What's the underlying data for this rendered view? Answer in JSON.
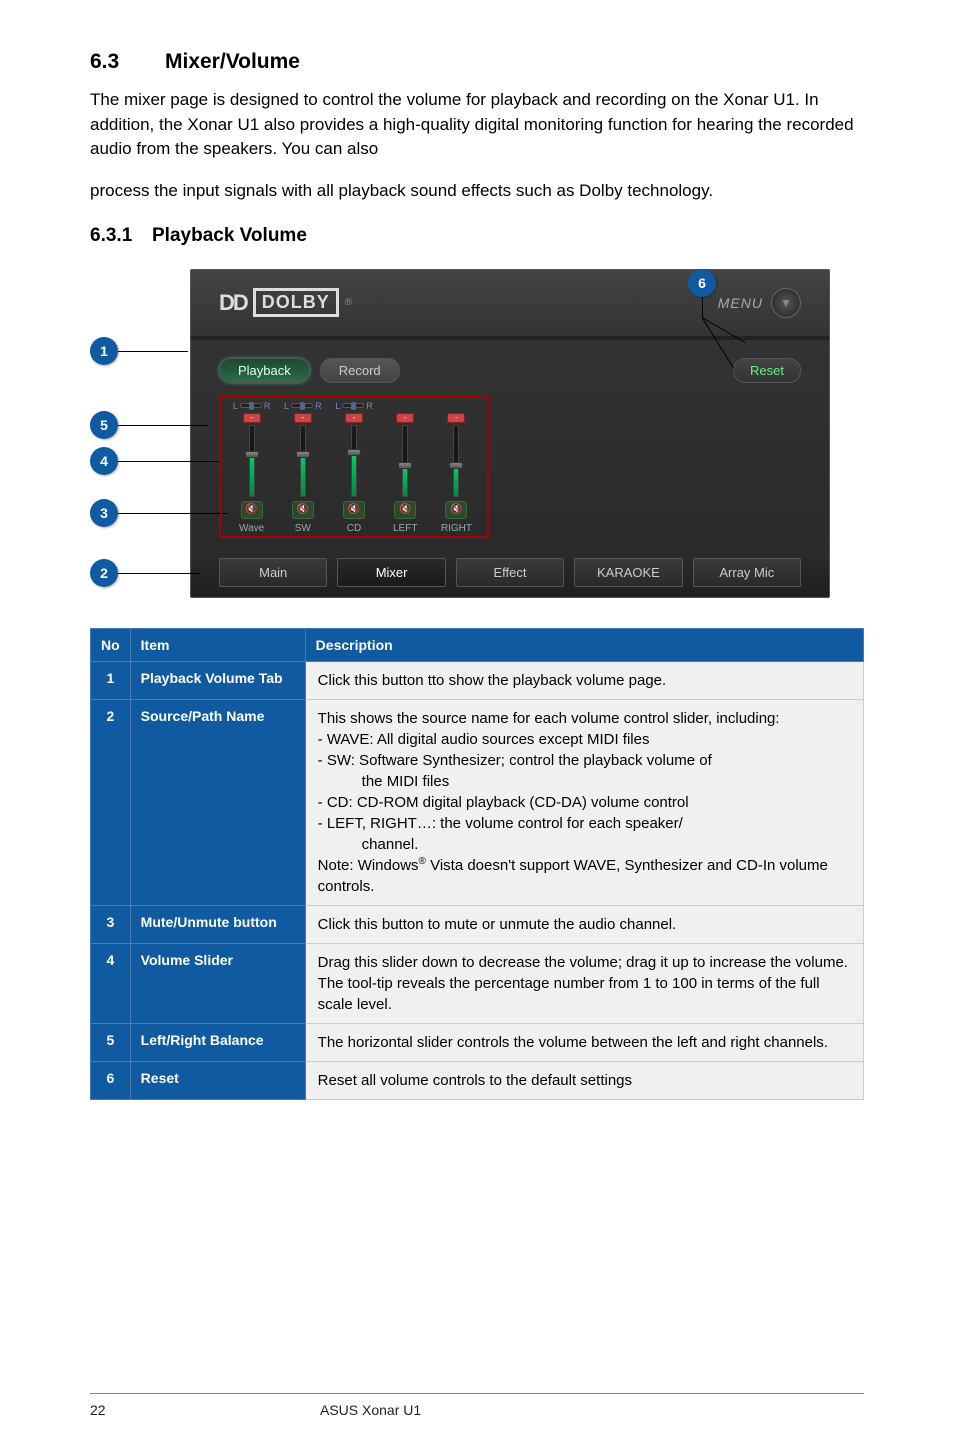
{
  "section": {
    "number": "6.3",
    "title": "Mixer/Volume"
  },
  "subsection": {
    "number": "6.3.1",
    "title": "Playback Volume"
  },
  "intro_para": "The mixer page is designed to control the volume for playback and recording on the Xonar U1. In addition, the Xonar U1 also provides a high-quality digital monitoring function for hearing the recorded audio from the speakers. You can also",
  "intro_para2": "process the input signals with all playback sound effects such as Dolby technology.",
  "figure": {
    "callouts": {
      "c1": "1",
      "c2": "2",
      "c3": "3",
      "c4": "4",
      "c5": "5",
      "c6": "6"
    },
    "dolby_brand": "DOLBY",
    "dolby_dd": "DD",
    "menu_label": "MENU",
    "menu_glyph": "▼",
    "tabs": {
      "playback": "Playback",
      "record": "Record"
    },
    "reset": "Reset",
    "balance_L": "L",
    "balance_R": "R",
    "mute_glyph": "🔇",
    "channels": {
      "wave": {
        "name": "Wave",
        "fill": 55
      },
      "sw": {
        "name": "SW",
        "fill": 55
      },
      "cd": {
        "name": "CD",
        "fill": 58
      },
      "left": {
        "name": "LEFT",
        "fill": 40
      },
      "right": {
        "name": "RIGHT",
        "fill": 40
      }
    },
    "bottom_tabs": {
      "main": "Main",
      "mixer": "Mixer",
      "effect": "Effect",
      "karaoke": "KARAOKE",
      "arraymic": "Array Mic"
    }
  },
  "table": {
    "headers": {
      "no": "No",
      "item": "Item",
      "desc": "Description"
    },
    "rows": {
      "r1": {
        "no": "1",
        "item": "Playback Volume Tab",
        "desc": "Click this button tto show the playback volume page."
      },
      "r2": {
        "no": "2",
        "item": "Source/Path Name",
        "l1": "This shows the source name for each volume control slider, including:",
        "l2": "- WAVE: All digital audio sources except MIDI files",
        "l3a": "- SW: Software Synthesizer; control the playback volume of",
        "l3b": "the MIDI files",
        "l4": "- CD: CD-ROM digital playback (CD-DA) volume control",
        "l5a": "- LEFT, RIGHT…: the volume control for each speaker/",
        "l5b": "channel.",
        "l6a": "Note: Windows",
        "l6b": " Vista doesn't support WAVE, Synthesizer and CD-In volume controls."
      },
      "r3": {
        "no": "3",
        "item": "Mute/Unmute button",
        "desc": "Click this button to mute or unmute the audio channel."
      },
      "r4": {
        "no": "4",
        "item": "Volume Slider",
        "desc": "Drag this slider down to decrease the volume; drag it up to increase the volume. The tool-tip reveals the percentage number from 1 to 100 in terms of the full scale level."
      },
      "r5": {
        "no": "5",
        "item": "Left/Right Balance",
        "desc": "The horizontal slider controls the volume between the left and right channels."
      },
      "r6": {
        "no": "6",
        "item": "Reset",
        "desc": "Reset all volume controls to the default settings"
      }
    }
  },
  "footer": {
    "page": "22",
    "doc": "ASUS Xonar U1"
  }
}
